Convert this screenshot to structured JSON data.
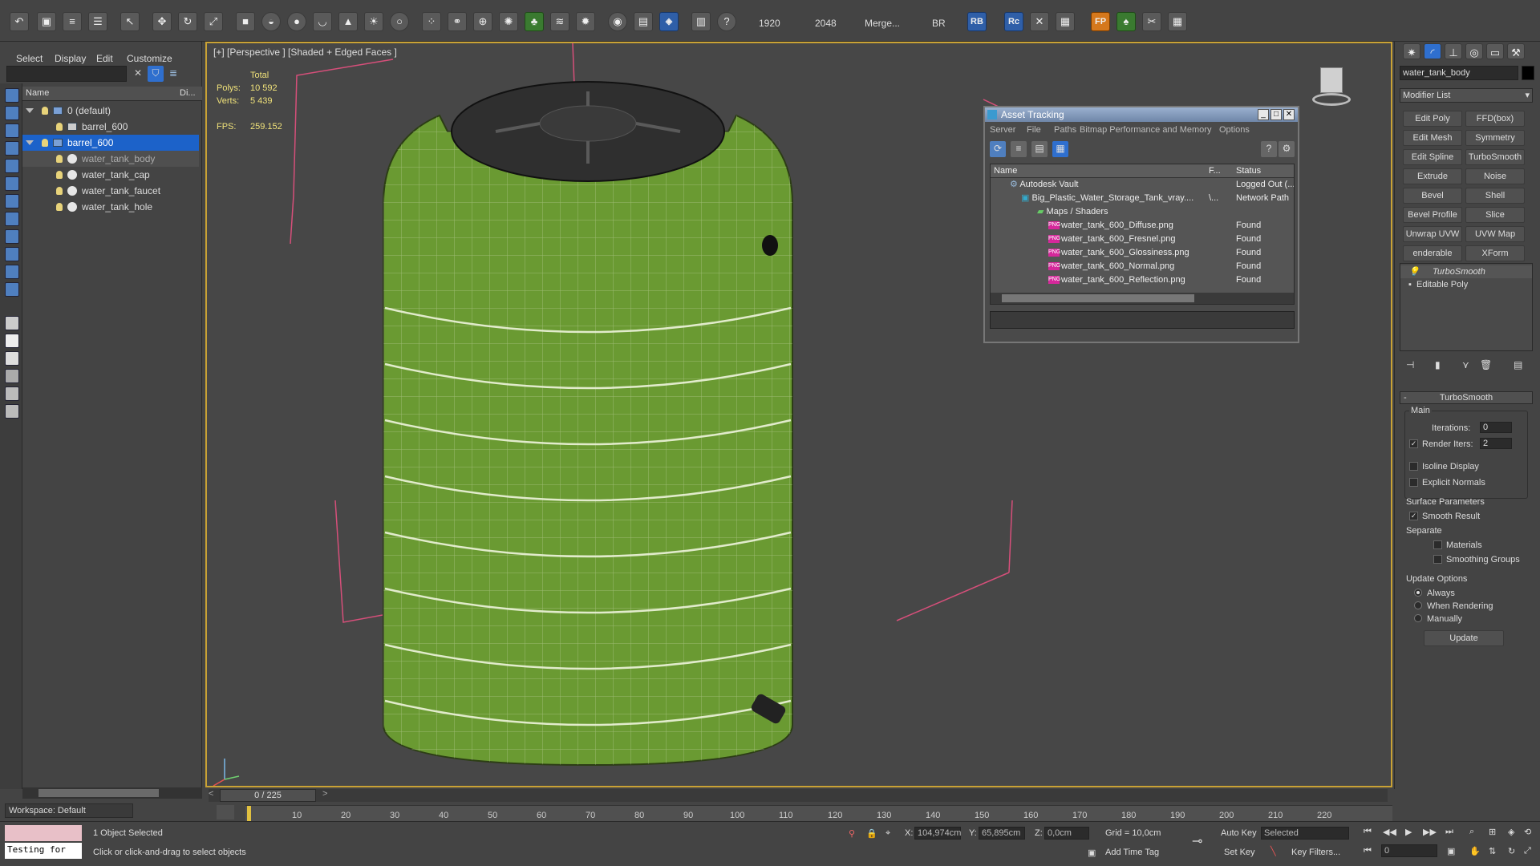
{
  "toolbar": {
    "render_width": "1920",
    "render_height": "2048",
    "merge_label": "Merge...",
    "br_label": "BR",
    "rb_label": "RB",
    "rc_label": "Rc",
    "fp_label": "FP",
    "help_label": "?"
  },
  "explorer": {
    "menu": [
      "Select",
      "Display",
      "Edit",
      "Customize"
    ],
    "column_name": "Name",
    "column_di": "Di...",
    "rows": [
      {
        "label": "0 (default)",
        "indent": 0,
        "state": "normal"
      },
      {
        "label": "barrel_600",
        "indent": 1,
        "state": "normal"
      },
      {
        "label": "barrel_600",
        "indent": 0,
        "state": "selected"
      },
      {
        "label": "water_tank_body",
        "indent": 1,
        "state": "highlight"
      },
      {
        "label": "water_tank_cap",
        "indent": 1,
        "state": "normal"
      },
      {
        "label": "water_tank_faucet",
        "indent": 1,
        "state": "normal"
      },
      {
        "label": "water_tank_hole",
        "indent": 1,
        "state": "normal"
      }
    ],
    "workspace": "Workspace: Default"
  },
  "viewport": {
    "label": "[+] [Perspective ] [Shaded + Edged Faces ]",
    "stats_header": "Total",
    "polys_label": "Polys:",
    "polys_value": "10 592",
    "verts_label": "Verts:",
    "verts_value": "5 439",
    "fps_label": "FPS:",
    "fps_value": "259.152",
    "tank_color": "#6a9a32",
    "lid_color": "#2f2f2f"
  },
  "asset_tracking": {
    "title": "Asset Tracking",
    "menu": [
      "Server",
      "File",
      "Paths",
      "Bitmap Performance and Memory",
      "Options"
    ],
    "columns": {
      "name": "Name",
      "full": "F...",
      "status": "Status"
    },
    "rows": [
      {
        "name": "Autodesk Vault",
        "full": "",
        "status": "Logged Out (...",
        "indent": 1,
        "kind": "vault"
      },
      {
        "name": "Big_Plastic_Water_Storage_Tank_vray....",
        "full": "\\...",
        "status": "Network Path",
        "indent": 2,
        "kind": "max"
      },
      {
        "name": "Maps / Shaders",
        "full": "",
        "status": "",
        "indent": 3,
        "kind": "folder"
      },
      {
        "name": "water_tank_600_Diffuse.png",
        "full": "",
        "status": "Found",
        "indent": 4,
        "kind": "png"
      },
      {
        "name": "water_tank_600_Fresnel.png",
        "full": "",
        "status": "Found",
        "indent": 4,
        "kind": "png"
      },
      {
        "name": "water_tank_600_Glossiness.png",
        "full": "",
        "status": "Found",
        "indent": 4,
        "kind": "png"
      },
      {
        "name": "water_tank_600_Normal.png",
        "full": "",
        "status": "Found",
        "indent": 4,
        "kind": "png"
      },
      {
        "name": "water_tank_600_Reflection.png",
        "full": "",
        "status": "Found",
        "indent": 4,
        "kind": "png"
      }
    ],
    "png_badge": "PNG"
  },
  "command_panel": {
    "object_name": "water_tank_body",
    "modifier_list": "Modifier List",
    "modifier_buttons": [
      "Edit Poly",
      "FFD(box)",
      "Edit Mesh",
      "Symmetry",
      "Edit Spline",
      "TurboSmooth",
      "Extrude",
      "Noise",
      "Bevel",
      "Shell",
      "Bevel Profile",
      "Slice",
      "Unwrap UVW",
      "UVW Map",
      "enderable Splir",
      "XForm"
    ],
    "stack": [
      "TurboSmooth",
      "Editable Poly"
    ],
    "rollout_title": "TurboSmooth",
    "main_label": "Main",
    "iterations_label": "Iterations:",
    "iterations_value": "0",
    "render_iters_label": "Render Iters:",
    "render_iters_value": "2",
    "isoline_label": "Isoline Display",
    "explicit_normals_label": "Explicit Normals",
    "surface_params_label": "Surface Parameters",
    "smooth_result_label": "Smooth Result",
    "separate_label": "Separate",
    "materials_label": "Materials",
    "smoothing_groups_label": "Smoothing Groups",
    "update_options_label": "Update Options",
    "always_label": "Always",
    "when_rendering_label": "When Rendering",
    "manually_label": "Manually",
    "update_button": "Update"
  },
  "timeline": {
    "frame_counter": "0 / 225",
    "ticks": [
      "10",
      "20",
      "30",
      "40",
      "50",
      "60",
      "70",
      "80",
      "90",
      "100",
      "110",
      "120",
      "130",
      "140",
      "150",
      "160",
      "170",
      "180",
      "190",
      "200",
      "210",
      "220"
    ]
  },
  "status": {
    "selected_text": "1 Object Selected",
    "prompt_text": "Click or click-and-drag to select objects",
    "maxscript_text": "Testing for",
    "x_label": "X:",
    "x_value": "104,974cm",
    "y_label": "Y:",
    "y_value": "65,895cm",
    "z_label": "Z:",
    "z_value": "0,0cm",
    "grid_text": "Grid = 10,0cm",
    "add_time_tag": "Add Time Tag",
    "auto_key": "Auto Key",
    "set_key": "Set Key",
    "selected_dropdown": "Selected",
    "key_filters": "Key Filters...",
    "frame_value": "0"
  }
}
